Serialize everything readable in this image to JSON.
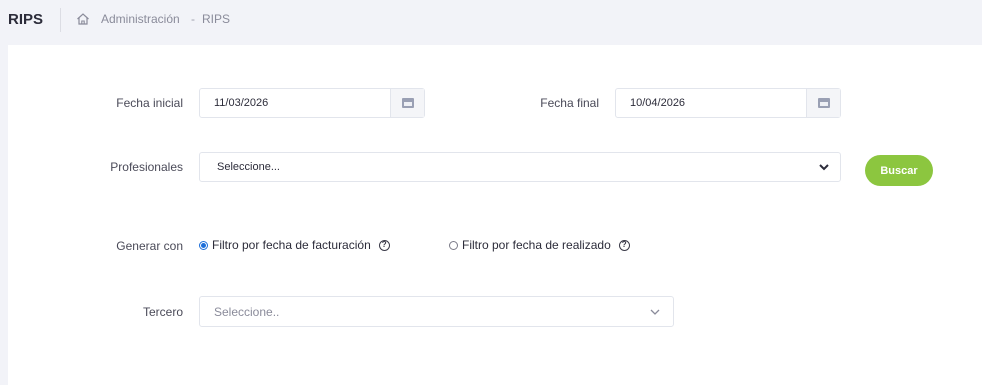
{
  "header": {
    "title": "RIPS",
    "breadcrumb": {
      "section": "Administración",
      "separator": "-",
      "current": "RIPS"
    }
  },
  "form": {
    "fecha_inicial": {
      "label": "Fecha inicial",
      "value": "11/03/2026"
    },
    "fecha_final": {
      "label": "Fecha final",
      "value": "10/04/2026"
    },
    "profesionales": {
      "label": "Profesionales",
      "selected": "Seleccione..."
    },
    "buscar_label": "Buscar",
    "generar_con": {
      "label": "Generar con",
      "options": [
        {
          "label": "Filtro por fecha de facturación",
          "checked": true
        },
        {
          "label": "Filtro por fecha de realizado",
          "checked": false
        }
      ]
    },
    "tercero": {
      "label": "Tercero",
      "placeholder": "Seleccione.."
    }
  },
  "icons": {
    "home": "home-icon",
    "calendar": "calendar-icon",
    "chevron": "chevron-down-icon",
    "help": "help-circle-icon"
  },
  "colors": {
    "accent_button": "#8cc63f",
    "radio_checked": "#1e6fd9",
    "page_background": "#f2f3f8"
  }
}
